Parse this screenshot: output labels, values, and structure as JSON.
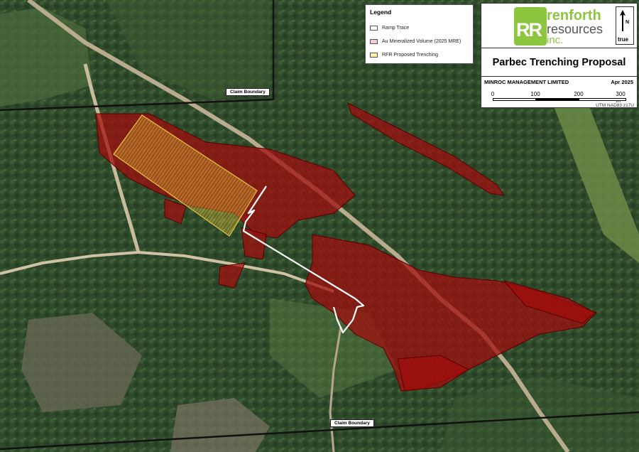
{
  "map_title": "Parbec Trenching Proposal",
  "company": "MINROC MANAGEMENT LIMITED",
  "date": "Apr 2025",
  "logo": {
    "mark": "RR",
    "word1": "renforth",
    "word2": "resources",
    "word3": "inc."
  },
  "north_arrow": {
    "n_label": "N",
    "true_label": "true"
  },
  "legend": {
    "title": "Legend",
    "items": [
      {
        "label": "Ramp Trace",
        "color": "#ffffff"
      },
      {
        "label": "Au Mineralized Volume (2025 MRE)",
        "color": "#f4cccc"
      },
      {
        "label": "RFR Proposed Trenching",
        "color": "#fff2a8"
      }
    ]
  },
  "scale_bar": {
    "ticks": [
      "0",
      "100",
      "200",
      "300 m"
    ]
  },
  "projection": "UTM NAD83 z17U",
  "claim_labels": {
    "top": "Claim Boundary",
    "bottom": "Claim Boundary"
  },
  "colors": {
    "forest": "#2d4a2a",
    "mineralized": "#b01010",
    "trench": "#e8c640",
    "claim_line": "#111111"
  }
}
